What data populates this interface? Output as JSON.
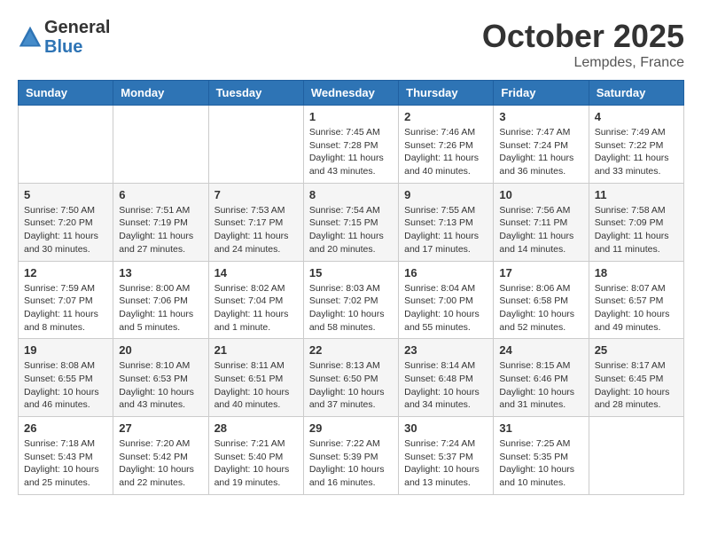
{
  "header": {
    "logo_line1": "General",
    "logo_line2": "Blue",
    "month": "October 2025",
    "location": "Lempdes, France"
  },
  "weekdays": [
    "Sunday",
    "Monday",
    "Tuesday",
    "Wednesday",
    "Thursday",
    "Friday",
    "Saturday"
  ],
  "weeks": [
    [
      {
        "day": "",
        "info": ""
      },
      {
        "day": "",
        "info": ""
      },
      {
        "day": "",
        "info": ""
      },
      {
        "day": "1",
        "info": "Sunrise: 7:45 AM\nSunset: 7:28 PM\nDaylight: 11 hours and 43 minutes."
      },
      {
        "day": "2",
        "info": "Sunrise: 7:46 AM\nSunset: 7:26 PM\nDaylight: 11 hours and 40 minutes."
      },
      {
        "day": "3",
        "info": "Sunrise: 7:47 AM\nSunset: 7:24 PM\nDaylight: 11 hours and 36 minutes."
      },
      {
        "day": "4",
        "info": "Sunrise: 7:49 AM\nSunset: 7:22 PM\nDaylight: 11 hours and 33 minutes."
      }
    ],
    [
      {
        "day": "5",
        "info": "Sunrise: 7:50 AM\nSunset: 7:20 PM\nDaylight: 11 hours and 30 minutes."
      },
      {
        "day": "6",
        "info": "Sunrise: 7:51 AM\nSunset: 7:19 PM\nDaylight: 11 hours and 27 minutes."
      },
      {
        "day": "7",
        "info": "Sunrise: 7:53 AM\nSunset: 7:17 PM\nDaylight: 11 hours and 24 minutes."
      },
      {
        "day": "8",
        "info": "Sunrise: 7:54 AM\nSunset: 7:15 PM\nDaylight: 11 hours and 20 minutes."
      },
      {
        "day": "9",
        "info": "Sunrise: 7:55 AM\nSunset: 7:13 PM\nDaylight: 11 hours and 17 minutes."
      },
      {
        "day": "10",
        "info": "Sunrise: 7:56 AM\nSunset: 7:11 PM\nDaylight: 11 hours and 14 minutes."
      },
      {
        "day": "11",
        "info": "Sunrise: 7:58 AM\nSunset: 7:09 PM\nDaylight: 11 hours and 11 minutes."
      }
    ],
    [
      {
        "day": "12",
        "info": "Sunrise: 7:59 AM\nSunset: 7:07 PM\nDaylight: 11 hours and 8 minutes."
      },
      {
        "day": "13",
        "info": "Sunrise: 8:00 AM\nSunset: 7:06 PM\nDaylight: 11 hours and 5 minutes."
      },
      {
        "day": "14",
        "info": "Sunrise: 8:02 AM\nSunset: 7:04 PM\nDaylight: 11 hours and 1 minute."
      },
      {
        "day": "15",
        "info": "Sunrise: 8:03 AM\nSunset: 7:02 PM\nDaylight: 10 hours and 58 minutes."
      },
      {
        "day": "16",
        "info": "Sunrise: 8:04 AM\nSunset: 7:00 PM\nDaylight: 10 hours and 55 minutes."
      },
      {
        "day": "17",
        "info": "Sunrise: 8:06 AM\nSunset: 6:58 PM\nDaylight: 10 hours and 52 minutes."
      },
      {
        "day": "18",
        "info": "Sunrise: 8:07 AM\nSunset: 6:57 PM\nDaylight: 10 hours and 49 minutes."
      }
    ],
    [
      {
        "day": "19",
        "info": "Sunrise: 8:08 AM\nSunset: 6:55 PM\nDaylight: 10 hours and 46 minutes."
      },
      {
        "day": "20",
        "info": "Sunrise: 8:10 AM\nSunset: 6:53 PM\nDaylight: 10 hours and 43 minutes."
      },
      {
        "day": "21",
        "info": "Sunrise: 8:11 AM\nSunset: 6:51 PM\nDaylight: 10 hours and 40 minutes."
      },
      {
        "day": "22",
        "info": "Sunrise: 8:13 AM\nSunset: 6:50 PM\nDaylight: 10 hours and 37 minutes."
      },
      {
        "day": "23",
        "info": "Sunrise: 8:14 AM\nSunset: 6:48 PM\nDaylight: 10 hours and 34 minutes."
      },
      {
        "day": "24",
        "info": "Sunrise: 8:15 AM\nSunset: 6:46 PM\nDaylight: 10 hours and 31 minutes."
      },
      {
        "day": "25",
        "info": "Sunrise: 8:17 AM\nSunset: 6:45 PM\nDaylight: 10 hours and 28 minutes."
      }
    ],
    [
      {
        "day": "26",
        "info": "Sunrise: 7:18 AM\nSunset: 5:43 PM\nDaylight: 10 hours and 25 minutes."
      },
      {
        "day": "27",
        "info": "Sunrise: 7:20 AM\nSunset: 5:42 PM\nDaylight: 10 hours and 22 minutes."
      },
      {
        "day": "28",
        "info": "Sunrise: 7:21 AM\nSunset: 5:40 PM\nDaylight: 10 hours and 19 minutes."
      },
      {
        "day": "29",
        "info": "Sunrise: 7:22 AM\nSunset: 5:39 PM\nDaylight: 10 hours and 16 minutes."
      },
      {
        "day": "30",
        "info": "Sunrise: 7:24 AM\nSunset: 5:37 PM\nDaylight: 10 hours and 13 minutes."
      },
      {
        "day": "31",
        "info": "Sunrise: 7:25 AM\nSunset: 5:35 PM\nDaylight: 10 hours and 10 minutes."
      },
      {
        "day": "",
        "info": ""
      }
    ]
  ]
}
